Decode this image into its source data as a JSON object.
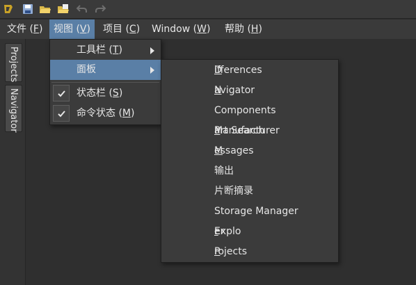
{
  "toolbar": {
    "buttons": [
      {
        "name": "app-logo-icon"
      },
      {
        "name": "save-icon"
      },
      {
        "name": "open-folder-icon"
      },
      {
        "name": "open-project-icon"
      },
      {
        "name": "undo-icon"
      },
      {
        "name": "redo-icon"
      }
    ]
  },
  "menubar": {
    "items": [
      {
        "label": "文件 (",
        "mnemonic": "F",
        "suffix": ")"
      },
      {
        "label": "视图 (",
        "mnemonic": "V",
        "suffix": ")"
      },
      {
        "label": "项目 (",
        "mnemonic": "C",
        "suffix": ")"
      },
      {
        "label": "Window (",
        "mnemonic": "W",
        "suffix": ")"
      },
      {
        "label": "帮助 (",
        "mnemonic": "H",
        "suffix": ")"
      }
    ]
  },
  "sidebar": {
    "tabs": [
      "Projects",
      "Navigator"
    ]
  },
  "view_menu": {
    "items": [
      {
        "label": "工具栏 (",
        "mnemonic": "T",
        "suffix": ")"
      },
      {
        "label": "面板"
      },
      {
        "label": "状态栏 (",
        "mnemonic": "S",
        "suffix": ")",
        "checked": true
      },
      {
        "label": "命令状态 (",
        "mnemonic": "M",
        "suffix": ")",
        "checked": true
      }
    ]
  },
  "panels_submenu": {
    "items": [
      {
        "pre": "",
        "mnemonic": "D",
        "post": "ifferences"
      },
      {
        "pre": "",
        "mnemonic": "N",
        "post": "avigator"
      },
      {
        "pre": "Components",
        "mnemonic": "",
        "post": ""
      },
      {
        "pre": "Manufacturer ",
        "mnemonic": "P",
        "post": "art Search"
      },
      {
        "pre": "",
        "mnemonic": "M",
        "post": "essages"
      },
      {
        "pre": "输出",
        "mnemonic": "",
        "post": ""
      },
      {
        "pre": "片断摘录",
        "mnemonic": "",
        "post": ""
      },
      {
        "pre": "Storage Manager",
        "mnemonic": "",
        "post": ""
      },
      {
        "pre": "Explo",
        "mnemonic": "r",
        "post": "er"
      },
      {
        "pre": "",
        "mnemonic": "P",
        "post": "rojects"
      }
    ]
  },
  "colors": {
    "highlight": "#5a7fa6",
    "background": "#2b2b2b",
    "menu_bg": "#3b3b3b"
  }
}
